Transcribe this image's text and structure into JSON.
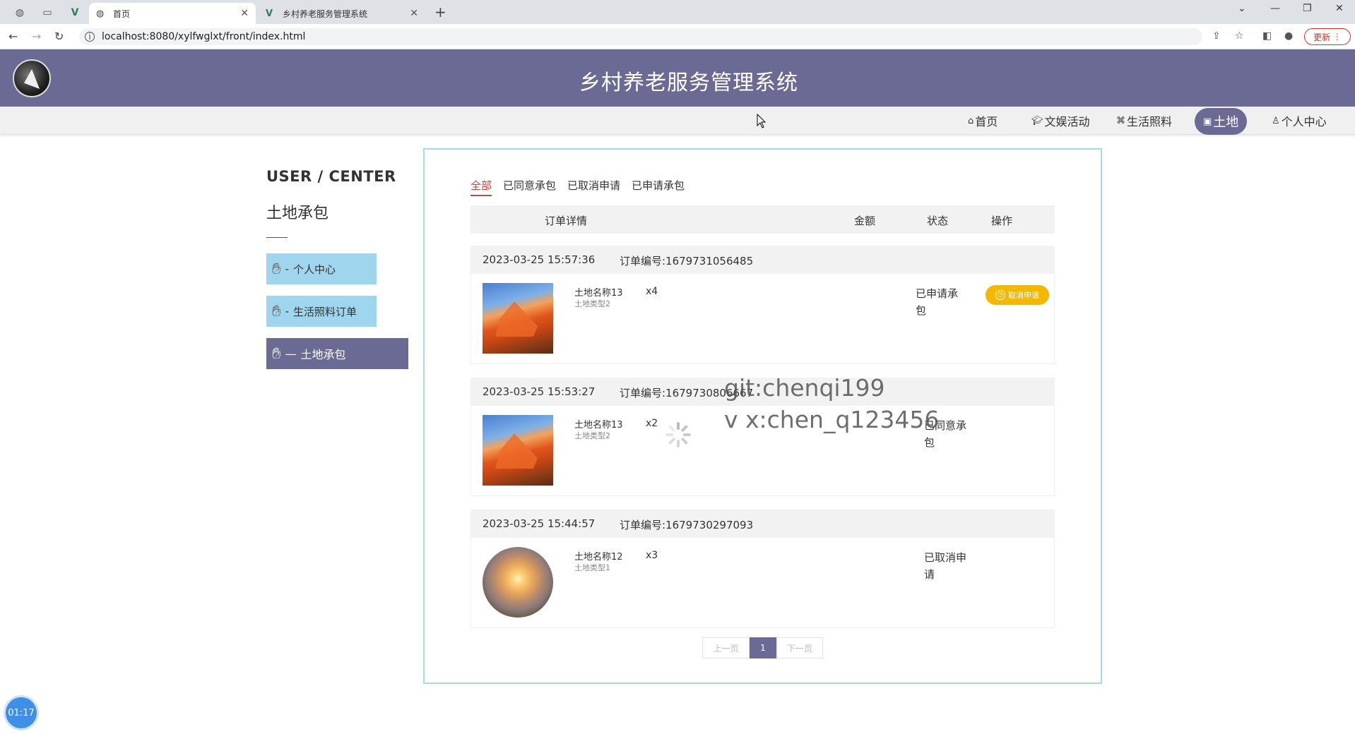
{
  "browser": {
    "tabs": [
      {
        "title": "首页",
        "active": true
      },
      {
        "title": "乡村养老服务管理系统",
        "active": false
      }
    ],
    "url": "localhost:8080/xylfwglxt/front/index.html",
    "update_label": "更新"
  },
  "site": {
    "title": "乡村养老服务管理系统",
    "nav": [
      {
        "label": "首页",
        "icon": "home-icon"
      },
      {
        "label": "文娱活动",
        "icon": "graduation-cap-icon"
      },
      {
        "label": "生活照料",
        "icon": "gamepad-icon"
      },
      {
        "label": "土地",
        "icon": "gift-icon",
        "active": true
      },
      {
        "label": "个人中心",
        "icon": "user-icon"
      }
    ]
  },
  "sidebar": {
    "title": "USER / CENTER",
    "subtitle": "土地承包",
    "items": [
      {
        "prefix": "-",
        "label": "个人中心"
      },
      {
        "prefix": "-",
        "label": "生活照料订单"
      },
      {
        "prefix": "—",
        "label": "土地承包",
        "active": true
      }
    ]
  },
  "filters": [
    "全部",
    "已同意承包",
    "已取消申请",
    "已申请承包"
  ],
  "table_headers": {
    "detail": "订单详情",
    "amount": "金额",
    "status": "状态",
    "action": "操作"
  },
  "orders": [
    {
      "datetime": "2023-03-25 15:57:36",
      "order_no": "订单编号:1679731056485",
      "name": "土地名称13",
      "type": "土地类型2",
      "qty": "x4",
      "status": "已申请承包",
      "action": "取消申请",
      "image": "red-rock"
    },
    {
      "datetime": "2023-03-25 15:53:27",
      "order_no": "订单编号:1679730806667",
      "name": "土地名称13",
      "type": "土地类型2",
      "qty": "x2",
      "status": "已同意承包",
      "image": "red-rock"
    },
    {
      "datetime": "2023-03-25 15:44:57",
      "order_no": "订单编号:1679730297093",
      "name": "土地名称12",
      "type": "土地类型1",
      "qty": "x3",
      "status": "已取消申请",
      "image": "desert-sunset"
    }
  ],
  "pagination": {
    "prev": "上一页",
    "current": "1",
    "next": "下一页"
  },
  "watermark": {
    "line1": "git:chenqi199",
    "line2": "v x:chen_q123456"
  },
  "timer": "01:17",
  "colors": {
    "brand": "#6b6a94",
    "sidebar_light": "#9fd6ee",
    "accent_red": "#d23f3f",
    "cancel_button": "#f5b800",
    "panel_border": "#a8d8ee"
  }
}
